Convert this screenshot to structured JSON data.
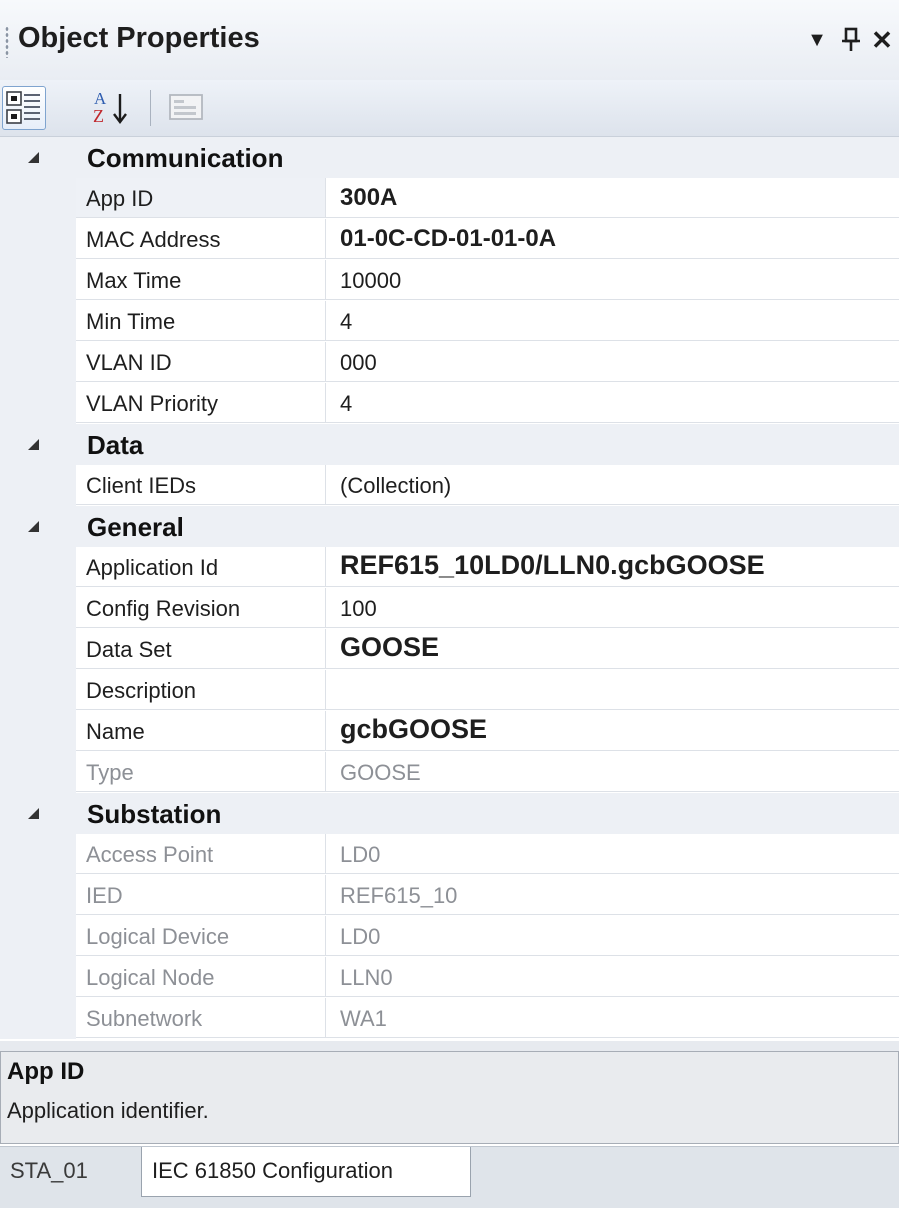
{
  "window": {
    "title": "Object Properties",
    "buttons": {
      "dropdown": "▼",
      "pin": "ᚠ",
      "close": "✕"
    }
  },
  "toolbar": {
    "categorized_icon": "categorized-icon",
    "alphabetical_icon": "alphabetical-icon",
    "property_pages_icon": "property-pages-icon",
    "alpha_top": "A",
    "alpha_bottom": "Z"
  },
  "categories": [
    {
      "name": "Communication",
      "properties": [
        {
          "name": "App ID",
          "value": "300A",
          "style": "bold",
          "readonly": false
        },
        {
          "name": "MAC Address",
          "value": "01-0C-CD-01-01-0A",
          "style": "bold",
          "readonly": false
        },
        {
          "name": "Max Time",
          "value": "10000",
          "style": "normal",
          "readonly": false
        },
        {
          "name": "Min Time",
          "value": "4",
          "style": "normal",
          "readonly": false
        },
        {
          "name": "VLAN ID",
          "value": "000",
          "style": "normal",
          "readonly": false
        },
        {
          "name": "VLAN Priority",
          "value": "4",
          "style": "normal",
          "readonly": false
        }
      ]
    },
    {
      "name": "Data",
      "properties": [
        {
          "name": "Client IEDs",
          "value": "(Collection)",
          "style": "normal",
          "readonly": false
        }
      ]
    },
    {
      "name": "General",
      "properties": [
        {
          "name": "Application Id",
          "value": "REF615_10LD0/LLN0.gcbGOOSE",
          "style": "big",
          "readonly": false
        },
        {
          "name": "Config Revision",
          "value": "100",
          "style": "normal",
          "readonly": false
        },
        {
          "name": "Data Set",
          "value": "GOOSE",
          "style": "big",
          "readonly": false
        },
        {
          "name": "Description",
          "value": "",
          "style": "normal",
          "readonly": false
        },
        {
          "name": "Name",
          "value": "gcbGOOSE",
          "style": "big",
          "readonly": false
        },
        {
          "name": "Type",
          "value": "GOOSE",
          "style": "normal",
          "readonly": true
        }
      ]
    },
    {
      "name": "Substation",
      "properties": [
        {
          "name": "Access Point",
          "value": "LD0",
          "style": "normal",
          "readonly": true
        },
        {
          "name": "IED",
          "value": "REF615_10",
          "style": "normal",
          "readonly": true
        },
        {
          "name": "Logical Device",
          "value": "LD0",
          "style": "normal",
          "readonly": true
        },
        {
          "name": "Logical Node",
          "value": "LLN0",
          "style": "normal",
          "readonly": true
        },
        {
          "name": "Subnetwork",
          "value": "WA1",
          "style": "normal",
          "readonly": true
        }
      ]
    }
  ],
  "description": {
    "title": "App ID",
    "text": "Application identifier."
  },
  "tabs": [
    {
      "label": "STA_01",
      "active": false
    },
    {
      "label": "IEC 61850 Configuration",
      "active": true
    }
  ],
  "colors": {
    "header_bg": "#e9edf3",
    "gutter_bg": "#edf0f5",
    "readonly_text": "#8d9096",
    "selected_border": "#7fa4cf"
  }
}
